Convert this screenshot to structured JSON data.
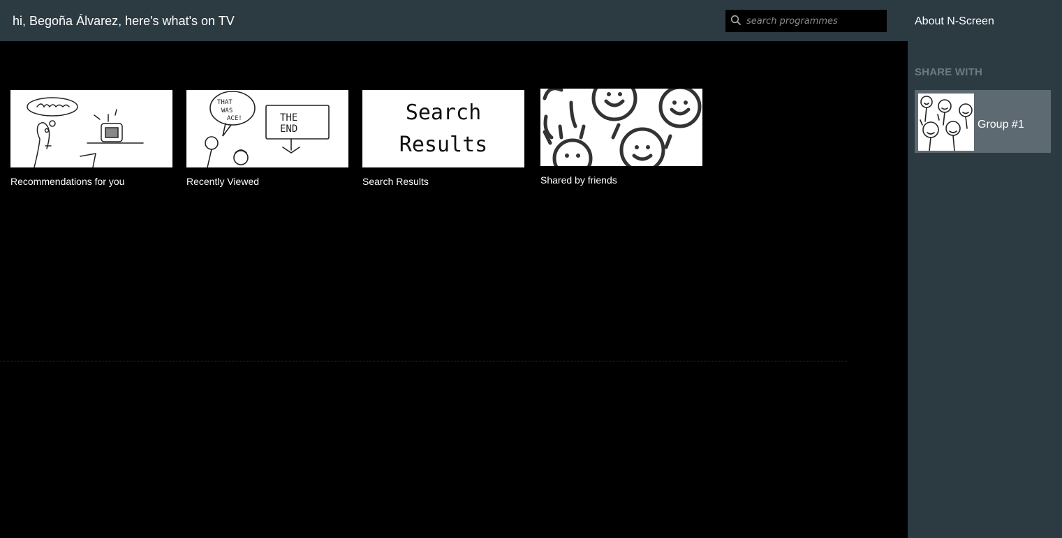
{
  "header": {
    "greeting": "hi, Begoña Álvarez, here's what's on TV",
    "search_placeholder": "search programmes",
    "search_icon": "search-icon"
  },
  "sidebar": {
    "about_label": "About N-Screen",
    "share_heading": "SHARE WITH",
    "groups": [
      {
        "name": "Group #1"
      }
    ]
  },
  "tiles": [
    {
      "caption": "Recommendations for you"
    },
    {
      "caption": "Recently Viewed"
    },
    {
      "caption": "Search Results",
      "thumb_text_1": "Search",
      "thumb_text_2": "Results"
    },
    {
      "caption": "Shared by friends"
    }
  ],
  "colors": {
    "bar": "#2c3a42",
    "group_card": "#5d6a71",
    "heading_muted": "#6c7a82",
    "background": "#000000"
  }
}
